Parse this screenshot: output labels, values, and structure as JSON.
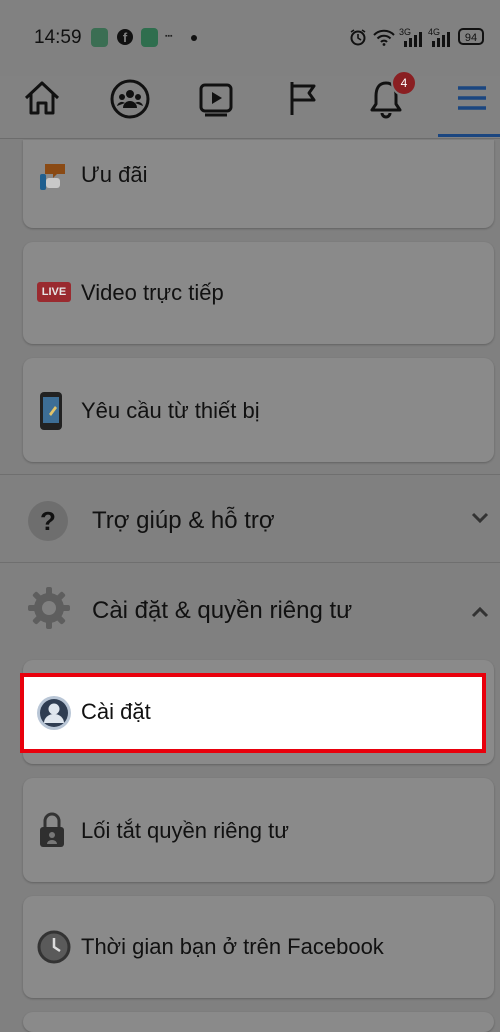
{
  "status_bar": {
    "time": "14:59",
    "network_3g": "3G",
    "network_4g": "4G",
    "battery": "94",
    "icons": [
      "app-icon",
      "facebook-icon",
      "app-icon",
      "small-text",
      "dot",
      "alarm-icon",
      "wifi-icon",
      "signal-icon",
      "signal-icon",
      "battery-icon"
    ]
  },
  "nav": {
    "items": [
      "home-icon",
      "groups-icon",
      "watch-icon",
      "pages-flag-icon",
      "notifications-bell-icon",
      "menu-icon"
    ],
    "notification_count": "4"
  },
  "menu_items": [
    {
      "label": "Ưu đãi",
      "icon": "offers-icon"
    },
    {
      "label": "Video trực tiếp",
      "icon": "live-icon",
      "icon_text": "LIVE"
    },
    {
      "label": "Yêu cầu từ thiết bị",
      "icon": "device-request-icon"
    }
  ],
  "sections": [
    {
      "label": "Trợ giúp & hỗ trợ",
      "icon": "help-icon",
      "expanded": false
    },
    {
      "label": "Cài đặt & quyền riêng tư",
      "icon": "gear-icon",
      "expanded": true
    }
  ],
  "settings_items": [
    {
      "label": "Cài đặt",
      "icon": "profile-settings-icon",
      "highlighted": true
    },
    {
      "label": "Lối tắt quyền riêng tư",
      "icon": "lock-icon"
    },
    {
      "label": "Thời gian bạn ở trên Facebook",
      "icon": "clock-icon"
    }
  ],
  "colors": {
    "highlight_border": "#e8000c",
    "badge": "#8a1f22",
    "nav_active": "#1b4680"
  }
}
